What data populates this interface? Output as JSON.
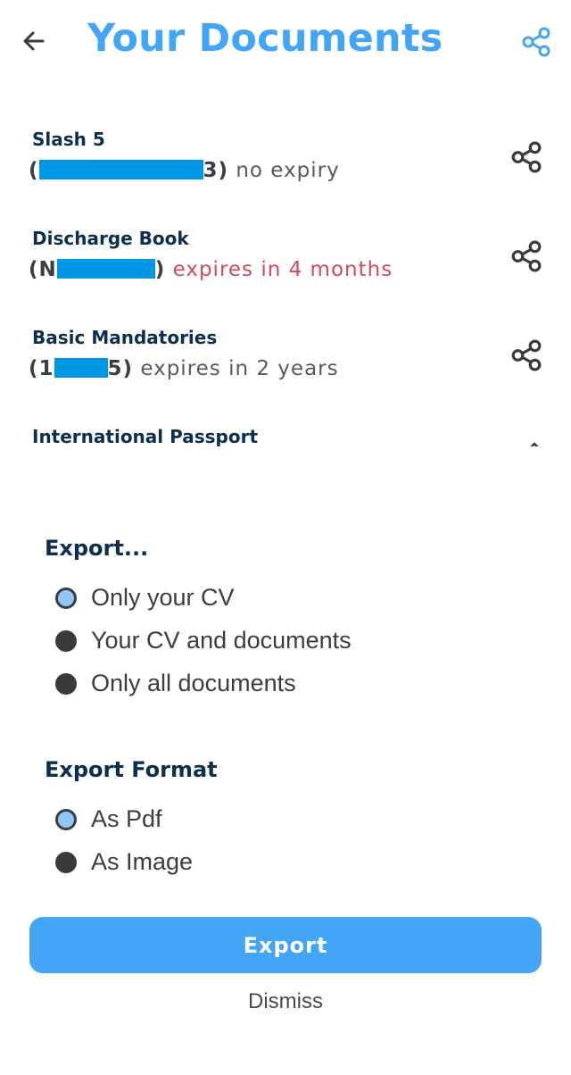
{
  "header": {
    "title": "Your Documents",
    "back_icon": "arrow-left-icon",
    "share_icon": "share-icon",
    "accent_color": "#42A5F5"
  },
  "documents": [
    {
      "name": "Slash 5",
      "number_start": "(",
      "number_end": "3)",
      "status": " no expiry",
      "status_color": "#555a60"
    },
    {
      "name": "Discharge Book",
      "number_start": "(N",
      "number_end": ")",
      "status": " expires in 4 months",
      "status_color": "#D04B5E"
    },
    {
      "name": "Basic Mandatories",
      "number_start": "(1",
      "number_end": "5)",
      "status": " expires in 2 years",
      "status_color": "#555a60"
    },
    {
      "name": "International Passport"
    }
  ],
  "export": {
    "title": "Export...",
    "options": [
      {
        "label": "Only your CV",
        "selected": true
      },
      {
        "label": "Your CV and documents",
        "selected": false
      },
      {
        "label": "Only all documents",
        "selected": false
      }
    ]
  },
  "export_format": {
    "title": "Export Format",
    "options": [
      {
        "label": "As Pdf",
        "selected": true
      },
      {
        "label": "As Image",
        "selected": false
      }
    ]
  },
  "actions": {
    "export_label": "Export",
    "dismiss_label": "Dismiss"
  }
}
